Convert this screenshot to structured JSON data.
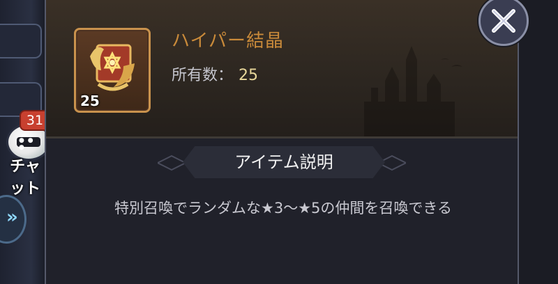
{
  "item": {
    "name": "ハイパー結晶",
    "count_badge": "25",
    "owned_label": "所有数：",
    "owned_value": "25"
  },
  "description": {
    "heading": "アイテム説明",
    "text": "特別召喚でランダムな★3〜★5の仲間を召喚できる"
  },
  "sidebar": {
    "chat_label": "チャ\nット",
    "chat_badge": "31"
  },
  "colors": {
    "item_name": "#c98a3a",
    "owned_value": "#e8d79a",
    "badge_red": "#c8402f"
  },
  "icons": {
    "close": "close-icon",
    "chat": "chat-bubble-icon",
    "expand": "double-chevron-right-icon",
    "item": "crystal-book-icon"
  }
}
